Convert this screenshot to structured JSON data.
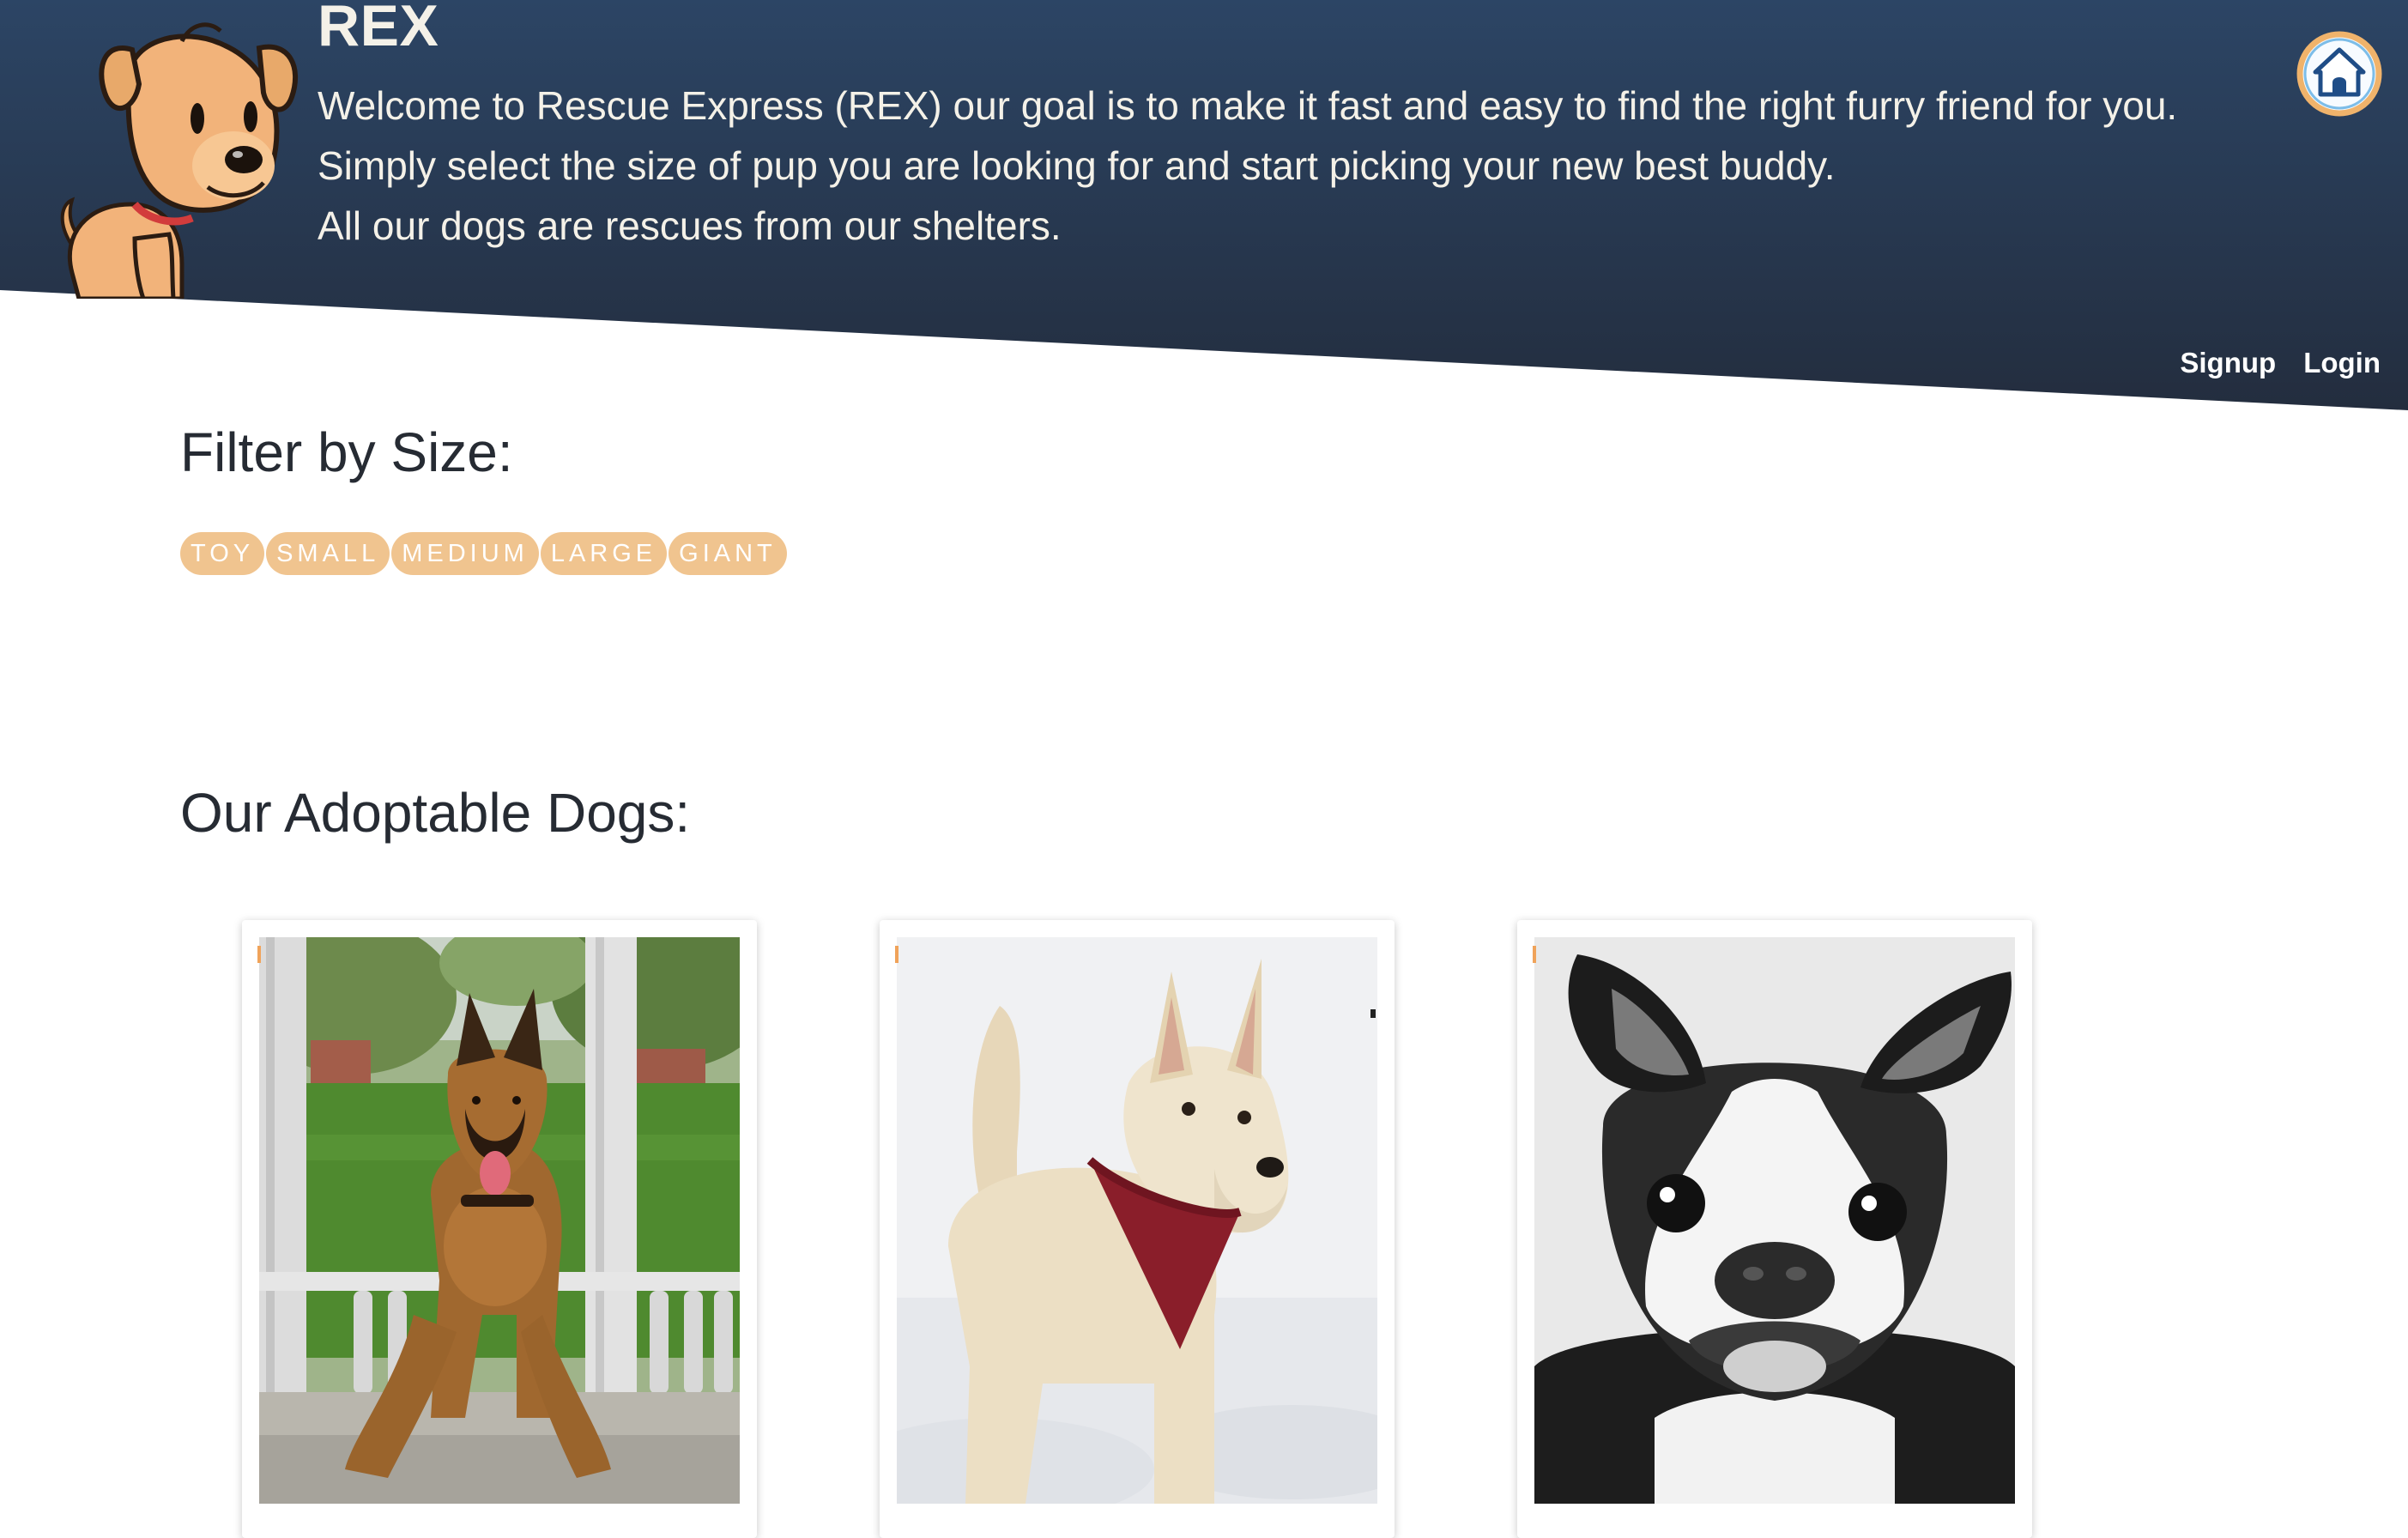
{
  "brand": {
    "title": "REX",
    "tagline": [
      "Welcome to Rescue Express (REX) our goal is to make it fast and easy to find the right furry friend for you.",
      "Simply select the size of pup you are looking for and start picking your new best buddy.",
      "All our dogs are rescues from our shelters."
    ],
    "logo_icon": "cartoon-dog-mascot",
    "home_icon": "doghouse-icon"
  },
  "nav": {
    "signup": "Signup",
    "login": "Login"
  },
  "filter": {
    "title": "Filter by Size:",
    "sizes": [
      "TOY",
      "SMALL",
      "MEDIUM",
      "LARGE",
      "GIANT"
    ]
  },
  "dogs": {
    "title": "Our Adoptable Dogs:",
    "items": [
      {
        "photo": "belgian-malinois-in-park"
      },
      {
        "photo": "wheaten-terrier-in-snow-with-red-bandana"
      },
      {
        "photo": "boston-terrier-black-and-white"
      }
    ]
  },
  "colors": {
    "header_top": "#2c4565",
    "header_bottom": "#232d3e",
    "pill": "#f0c48f",
    "text": "#262b33",
    "home_ring": "#f0b36b"
  }
}
